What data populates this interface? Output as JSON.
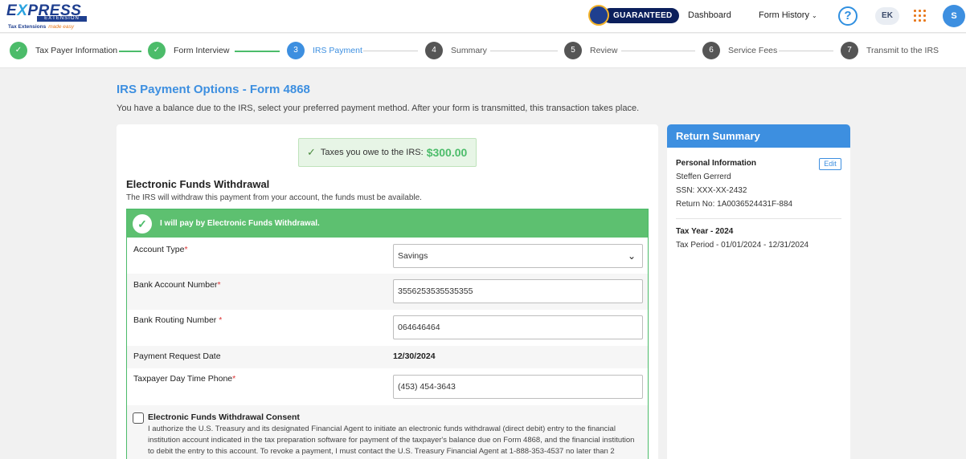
{
  "header": {
    "logo": {
      "brand_prefix": "E",
      "brand_x": "X",
      "brand_rest": "PRESS",
      "subtitle": "EXTENSION",
      "tagline": "Tax Extensions",
      "tagline_script": "made easy"
    },
    "guarantee_label": "GUARANTEED",
    "nav": {
      "dashboard": "Dashboard",
      "form_history": "Form History",
      "help": "?",
      "ek": "EK",
      "avatar_initial": "S"
    }
  },
  "steps": [
    {
      "num": "✓",
      "label": "Tax Payer Information",
      "state": "done"
    },
    {
      "num": "✓",
      "label": "Form Interview",
      "state": "done"
    },
    {
      "num": "3",
      "label": "IRS Payment",
      "state": "active"
    },
    {
      "num": "4",
      "label": "Summary",
      "state": "todo"
    },
    {
      "num": "5",
      "label": "Review",
      "state": "todo"
    },
    {
      "num": "6",
      "label": "Service Fees",
      "state": "todo"
    },
    {
      "num": "7",
      "label": "Transmit to the IRS",
      "state": "todo"
    }
  ],
  "page": {
    "title": "IRS Payment Options - Form 4868",
    "subtitle": "You have a balance due to the IRS, select your preferred payment method. After your form is transmitted, this transaction takes place."
  },
  "owe": {
    "label": "Taxes you owe to the IRS:",
    "amount": "$300.00"
  },
  "efw": {
    "title": "Electronic Funds Withdrawal",
    "subtitle": "The IRS will withdraw this payment from your account, the funds must be available.",
    "option_label": "I will pay by Electronic Funds Withdrawal.",
    "account_type": {
      "label": "Account Type",
      "req": "*",
      "value": "Savings"
    },
    "account_number": {
      "label": "Bank Account Number",
      "req": "*",
      "value": "3556253535535355"
    },
    "routing_number": {
      "label": "Bank Routing Number ",
      "req": "*",
      "value": "064646464"
    },
    "payment_date": {
      "label": "Payment Request Date",
      "value": "12/30/2024"
    },
    "phone": {
      "label": "Taxpayer Day Time Phone",
      "req": "*",
      "value": "(453) 454-3643"
    },
    "consent": {
      "title": "Electronic Funds Withdrawal Consent",
      "text": "I authorize the U.S. Treasury and its designated Financial Agent to initiate an electronic funds withdrawal (direct debit) entry to the financial institution account indicated in the tax preparation software for payment of the taxpayer's balance due on Form 4868, and the financial institution to debit the entry to this account. To revoke a payment, I must contact the U.S. Treasury Financial Agent at 1-888-353-4537 no later than 2 business days prior to"
    }
  },
  "summary": {
    "title": "Return Summary",
    "personal_title": "Personal Information",
    "edit_label": "Edit",
    "name": "Steffen Gerrerd",
    "ssn": "SSN: XXX-XX-2432",
    "return_no": "Return No: 1A0036524431F-884",
    "tax_year": "Tax Year - 2024",
    "tax_period": "Tax Period - 01/01/2024 - 12/31/2024"
  }
}
